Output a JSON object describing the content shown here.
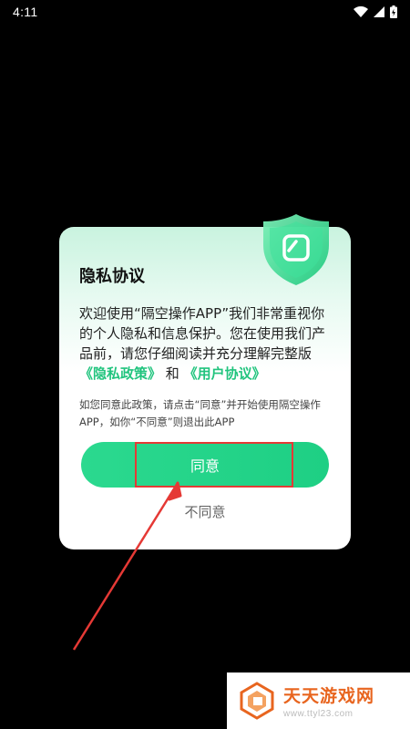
{
  "status_bar": {
    "time": "4:11",
    "icons": [
      "wifi-icon",
      "signal-icon",
      "battery-charging-icon"
    ]
  },
  "dialog": {
    "title": "隐私协议",
    "body_prefix": "欢迎使用“隔空操作APP”我们非常重视你的个人隐私和信息保护。您在使用我们产品前，请您仔细阅读并充分理解完整版",
    "privacy_policy_link": "《隐私政策》",
    "conjunction": "和",
    "user_agreement_link": "《用户协议》",
    "note": "如您同意此政策，请点击“同意”并开始使用隔空操作APP，如你“不同意”则退出此APP",
    "agree_label": "同意",
    "disagree_label": "不同意",
    "icon": "shield-icon"
  },
  "colors": {
    "accent": "#21c47e",
    "button": "#1fd086",
    "highlight": "#e53935"
  },
  "watermark": {
    "title": "天天游戏网",
    "url": "www.ttyl23.com"
  }
}
